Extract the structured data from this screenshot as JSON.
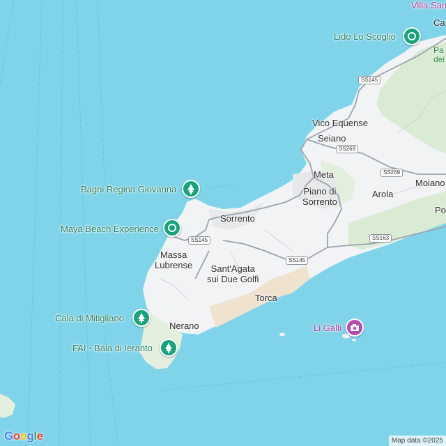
{
  "places": {
    "villa": "Villa San",
    "castellammare": "Ca",
    "vico_equense": "Vico Equense",
    "seiano": "Seiano",
    "meta": "Meta",
    "piano_di_sorrento_1": "Piano di",
    "piano_di_sorrento_2": "Sorrento",
    "sorrento": "Sorrento",
    "moiano": "Moiano",
    "arola": "Arola",
    "positano": "Po",
    "massa_1": "Massa",
    "massa_2": "Lubrense",
    "santagata_1": "Sant'Agata",
    "santagata_2": "sui Due Golfi",
    "torca": "Torca",
    "nerano": "Nerano"
  },
  "park_label": {
    "line1": "Pa",
    "line2": "dei"
  },
  "pois": {
    "lido_lo_scoglio": {
      "label": "Lido Lo Scoglio",
      "icon": "umbrella-icon",
      "color": "#16a47a"
    },
    "bagni_regina": {
      "label": "Bagni Regina Giovanna",
      "icon": "tree-icon",
      "color": "#16a47a"
    },
    "maya_beach": {
      "label": "Maya Beach Experience",
      "icon": "umbrella-icon",
      "color": "#16a47a"
    },
    "cala_mitigliano": {
      "label": "Cala di Mitigliano",
      "icon": "tree-icon",
      "color": "#16a47a"
    },
    "baia_ieranto": {
      "label": "FAI - Baia di Ieranto",
      "icon": "tree-icon",
      "color": "#16a47a"
    },
    "li_galli": {
      "label": "Li Galli",
      "icon": "camera-icon",
      "color": "#b34bb3"
    }
  },
  "roads": {
    "ss145_a": "SS145",
    "ss269_a": "SS269",
    "ss269_b": "SS269",
    "ss145_b": "SS145",
    "ss163": "SS163",
    "ss145_c": "SS145"
  },
  "logo": "Google",
  "attribution": "Map data ©2025"
}
